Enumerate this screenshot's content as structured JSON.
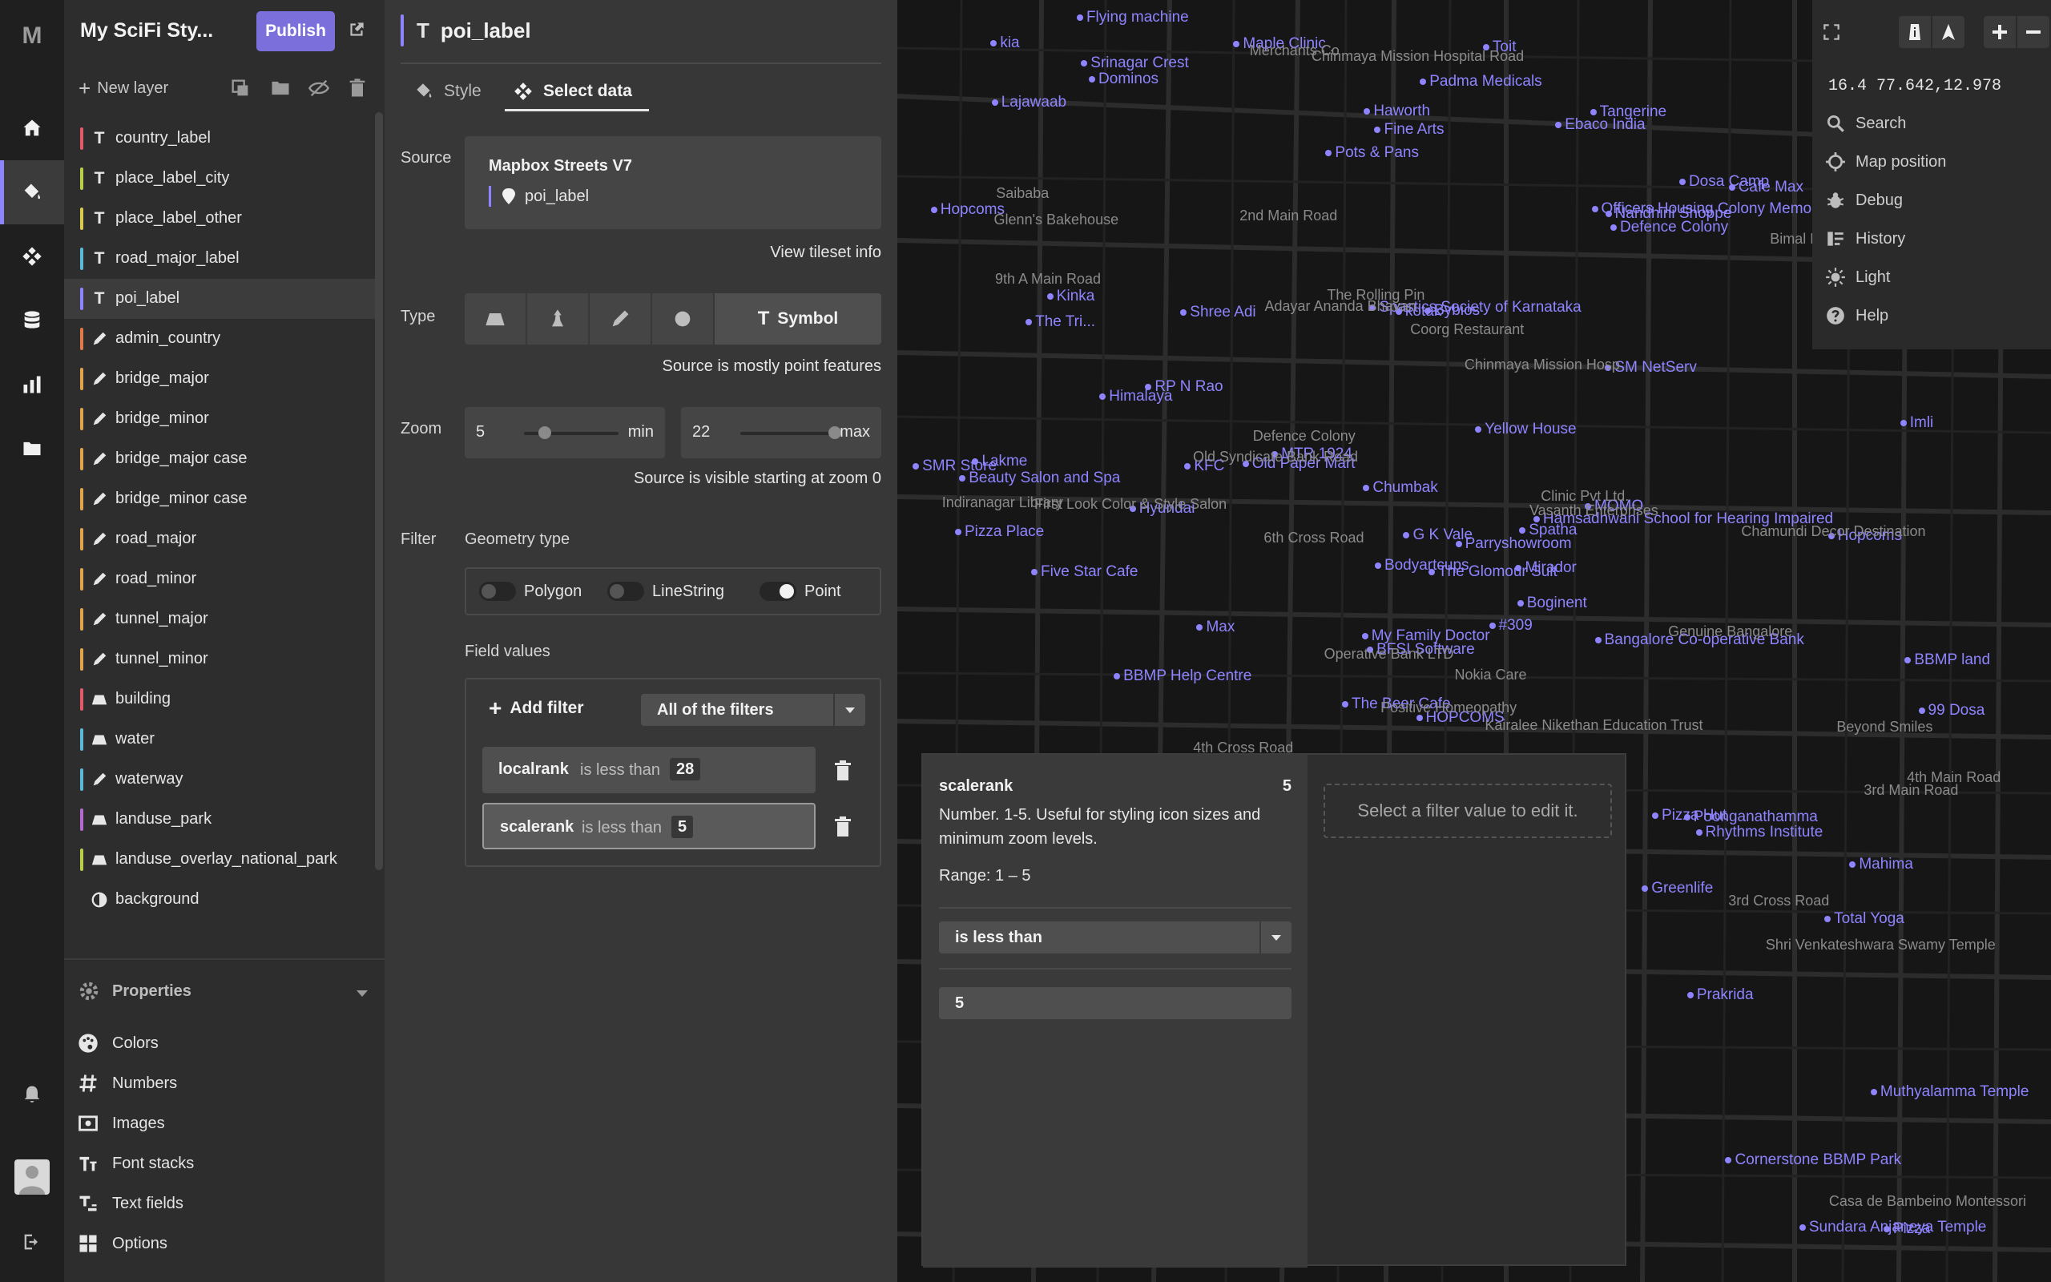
{
  "rail": {
    "logo": "M",
    "items": [
      "home-icon",
      "paint-bucket-icon",
      "move-icon",
      "database-icon",
      "chart-icon",
      "folder-icon"
    ],
    "active": "paint-bucket-icon"
  },
  "layer_panel": {
    "style_title": "My SciFi Sty...",
    "publish_label": "Publish",
    "new_layer_label": "New layer",
    "layers": [
      {
        "name": "country_label",
        "type": "symbol",
        "color": "#e05a6a"
      },
      {
        "name": "place_label_city",
        "type": "symbol",
        "color": "#b8cf4a"
      },
      {
        "name": "place_label_other",
        "type": "symbol",
        "color": "#d9c94e"
      },
      {
        "name": "road_major_label",
        "type": "symbol",
        "color": "#5bb8d6"
      },
      {
        "name": "poi_label",
        "type": "symbol",
        "color": "#8f84ff"
      },
      {
        "name": "admin_country",
        "type": "line",
        "color": "#e07a4a"
      },
      {
        "name": "bridge_major",
        "type": "line",
        "color": "#e0a54a"
      },
      {
        "name": "bridge_minor",
        "type": "line",
        "color": "#e0a54a"
      },
      {
        "name": "bridge_major case",
        "type": "line",
        "color": "#e0a54a"
      },
      {
        "name": "bridge_minor case",
        "type": "line",
        "color": "#e0a54a"
      },
      {
        "name": "road_major",
        "type": "line",
        "color": "#e0a54a"
      },
      {
        "name": "road_minor",
        "type": "line",
        "color": "#e0a54a"
      },
      {
        "name": "tunnel_major",
        "type": "line",
        "color": "#e0a54a"
      },
      {
        "name": "tunnel_minor",
        "type": "line",
        "color": "#e0a54a"
      },
      {
        "name": "building",
        "type": "fill",
        "color": "#e05a6a"
      },
      {
        "name": "water",
        "type": "fill",
        "color": "#5bb8d6"
      },
      {
        "name": "waterway",
        "type": "line",
        "color": "#5bb8d6"
      },
      {
        "name": "landuse_park",
        "type": "fill",
        "color": "#b06ad0"
      },
      {
        "name": "landuse_overlay_national_park",
        "type": "fill",
        "color": "#b8cf4a"
      },
      {
        "name": "background",
        "type": "background",
        "color": ""
      }
    ],
    "properties_title": "Properties",
    "properties": [
      "Colors",
      "Numbers",
      "Images",
      "Font stacks",
      "Text fields",
      "Options"
    ]
  },
  "editor": {
    "layer_name": "poi_label",
    "tabs": {
      "style": "Style",
      "data": "Select data"
    },
    "source_label": "Source",
    "source_name": "Mapbox Streets V7",
    "source_layer": "poi_label",
    "tileset_link": "View tileset info",
    "type_label": "Type",
    "type_selected": "Symbol",
    "type_hint": "Source is mostly point features",
    "zoom_label": "Zoom",
    "zoom_min": "5",
    "zoom_min_label": "min",
    "zoom_max": "22",
    "zoom_max_label": "max",
    "zoom_min_fraction": 0.22,
    "zoom_max_fraction": 1.0,
    "zoom_hint": "Source is visible starting at zoom 0",
    "filter_label": "Filter",
    "geometry_label": "Geometry type",
    "geometry": [
      {
        "label": "Polygon",
        "on": false
      },
      {
        "label": "LineString",
        "on": false
      },
      {
        "label": "Point",
        "on": true
      }
    ],
    "field_values_label": "Field values",
    "add_filter_label": "Add filter",
    "filter_mode": "All of the filters",
    "filters": [
      {
        "field": "localrank",
        "op": "is less than",
        "value": "28"
      },
      {
        "field": "scalerank",
        "op": "is less than",
        "value": "5"
      }
    ]
  },
  "map_controls": {
    "coords": "16.4 77.642,12.978",
    "items": [
      "Search",
      "Map position",
      "Debug",
      "History",
      "Light",
      "Help"
    ]
  },
  "popup": {
    "field": "scalerank",
    "count": "5",
    "description": "Number. 1-5. Useful for styling icon sizes and minimum zoom levels.",
    "range": "Range: 1 – 5",
    "operator": "is less than",
    "value": "5",
    "empty_hint": "Select a filter value to edit it."
  },
  "map": {
    "poi_labels": [
      "HOPCOMS",
      "The Tri...",
      "BFSI Software",
      "Spatha",
      "Tangerine",
      "Bybios",
      "Nandhini Shoppe",
      "#309",
      "Dominos",
      "Pizza",
      "Five Star Cafe",
      "The Beer Cafe",
      "SM NetServ",
      "Spastics Society of Karnataka",
      "Yellow House",
      "MTR 1924",
      "kotak",
      "Hamsadhwani School for Hearing Impaired",
      "Rhythms Institute",
      "Kinka",
      "Fine Arts",
      "Pizza Place",
      "Imli",
      "My Family Doctor",
      "Bodyartcups",
      "Shree Adi",
      "Dosa Camp",
      "Sundara Anjaneya Temple",
      "Muthyalamma Temple",
      "Poonganathamma",
      "Toit",
      "Old Paper Mart",
      "Hyundai",
      "SMR Store",
      "Mirador",
      "Boginent",
      "Hopcoms",
      "Greenlife",
      "Srinagar Crest",
      "kia",
      "Padma Medicals",
      "Max",
      "Lakme",
      "RP N Rao",
      "Cafe Max",
      "Flying machine",
      "Ebaco India",
      "Pots & Pans",
      "G K Vale",
      "Pizza Hut",
      "KFC",
      "Lajawaab",
      "Himalaya",
      "Chumbak",
      "Parryshowroom",
      "Bangalore Co-operative Bank",
      "Mahima",
      "Hopcoms",
      "Cornerstone BBMP Park",
      "Haworth",
      "99 Dosa",
      "MOMO",
      "Prakrida",
      "The Glomour Suit",
      "Total Yoga",
      "Beauty Salon and Spa",
      "Officers Housing Colony Memorial",
      "Defence Colony",
      "BBMP Help Centre",
      "Maple Clinic",
      "BBMP land"
    ],
    "road_labels": [
      "Indiranagar Library",
      "Vasanth Enterprises",
      "Bimal Maruti Sai Service Station",
      "6th Cross Road",
      "Beyond Smiles",
      "Glenn's Bakehouse",
      "Coorg Restaurant",
      "Operative Bank LTD",
      "Merchants Co",
      "Positive Homeopathy",
      "The Rolling Pin",
      "Chinmaya Mission Hospital Road",
      "Chinmaya Mission Hosp",
      "Adayar Ananda Bhavan",
      "Genuine Bangalore",
      "Casa de Bambeino Montessori",
      "Chamundi Decor Destination",
      "9th A Main Road",
      "Old Syndicate Bank Road",
      "2nd Main Road",
      "3rd Main Road",
      "3rd Cross Road",
      "4th Cross Road",
      "4th Main Road",
      "Defence Colony",
      "Kairalee Nikethan Education Trust",
      "First Look Color & Style Salon",
      "Shri Venkateshwara Swamy Temple",
      "Nokia Care",
      "Clinic Pvt Ltd.",
      "Saibaba"
    ]
  }
}
